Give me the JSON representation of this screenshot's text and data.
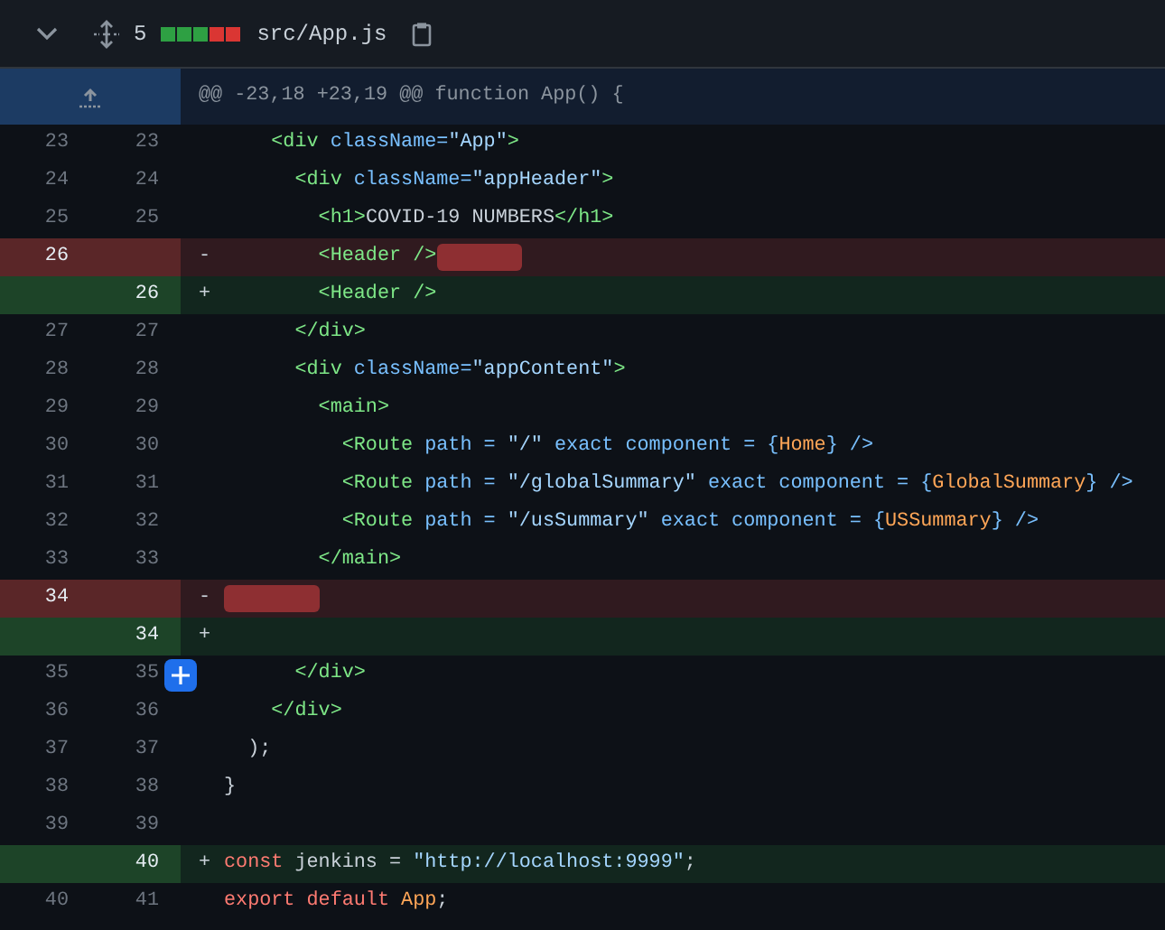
{
  "file_header": {
    "expanded": true,
    "changes": "5",
    "diffstat": [
      {
        "kind": "added"
      },
      {
        "kind": "added"
      },
      {
        "kind": "added"
      },
      {
        "kind": "deleted"
      },
      {
        "kind": "deleted"
      }
    ],
    "path": "src/App.js"
  },
  "hunk": {
    "text": "@@ -23,18 +23,19 @@ function App() {"
  },
  "lines": [
    {
      "kind": "context",
      "old": "23",
      "new": "23",
      "tokens": [
        {
          "kind": "tag",
          "text": "    <div "
        },
        {
          "kind": "attr",
          "text": "className="
        },
        {
          "kind": "str",
          "text": "\"App\""
        },
        {
          "kind": "tag",
          "text": ">"
        }
      ]
    },
    {
      "kind": "context",
      "old": "24",
      "new": "24",
      "tokens": [
        {
          "kind": "tag",
          "text": "      <div "
        },
        {
          "kind": "attr",
          "text": "className="
        },
        {
          "kind": "str",
          "text": "\"appHeader\""
        },
        {
          "kind": "tag",
          "text": ">"
        }
      ]
    },
    {
      "kind": "context",
      "old": "25",
      "new": "25",
      "tokens": [
        {
          "kind": "tag",
          "text": "        <h1>"
        },
        {
          "kind": "plain",
          "text": "COVID-19 NUMBERS"
        },
        {
          "kind": "tag",
          "text": "</h1>"
        }
      ]
    },
    {
      "kind": "del",
      "old": "26",
      "sign": "-",
      "whitespace_removed": true,
      "tokens": [
        {
          "kind": "tag",
          "text": "        <Header />"
        }
      ]
    },
    {
      "kind": "add",
      "new": "26",
      "sign": "+",
      "tokens": [
        {
          "kind": "tag",
          "text": "        <Header />"
        }
      ]
    },
    {
      "kind": "context",
      "old": "27",
      "new": "27",
      "tokens": [
        {
          "kind": "tag",
          "text": "      </div>"
        }
      ]
    },
    {
      "kind": "context",
      "old": "28",
      "new": "28",
      "tokens": [
        {
          "kind": "tag",
          "text": "      <div "
        },
        {
          "kind": "attr",
          "text": "className="
        },
        {
          "kind": "str",
          "text": "\"appContent\""
        },
        {
          "kind": "tag",
          "text": ">"
        }
      ]
    },
    {
      "kind": "context",
      "old": "29",
      "new": "29",
      "tokens": [
        {
          "kind": "tag",
          "text": "        <main>"
        }
      ]
    },
    {
      "kind": "context",
      "old": "30",
      "new": "30",
      "tokens": [
        {
          "kind": "tag",
          "text": "          <Route "
        },
        {
          "kind": "attr",
          "text": "path = "
        },
        {
          "kind": "str",
          "text": "\"/\""
        },
        {
          "kind": "attr",
          "text": " exact component = {"
        },
        {
          "kind": "const",
          "text": "Home"
        },
        {
          "kind": "attr",
          "text": "} />"
        }
      ]
    },
    {
      "kind": "context",
      "old": "31",
      "new": "31",
      "tokens": [
        {
          "kind": "tag",
          "text": "          <Route "
        },
        {
          "kind": "attr",
          "text": "path = "
        },
        {
          "kind": "str",
          "text": "\"/globalSummary\""
        },
        {
          "kind": "attr",
          "text": " exact component = {"
        },
        {
          "kind": "const",
          "text": "GlobalSummary"
        },
        {
          "kind": "attr",
          "text": "} />"
        }
      ]
    },
    {
      "kind": "context",
      "old": "32",
      "new": "32",
      "tokens": [
        {
          "kind": "tag",
          "text": "          <Route "
        },
        {
          "kind": "attr",
          "text": "path = "
        },
        {
          "kind": "str",
          "text": "\"/usSummary\""
        },
        {
          "kind": "attr",
          "text": " exact component = {"
        },
        {
          "kind": "const",
          "text": "USSummary"
        },
        {
          "kind": "attr",
          "text": "} />"
        }
      ]
    },
    {
      "kind": "context",
      "old": "33",
      "new": "33",
      "tokens": [
        {
          "kind": "tag",
          "text": "        </main>"
        }
      ]
    },
    {
      "kind": "del",
      "old": "34",
      "sign": "-",
      "whitespace_removed": true
    },
    {
      "kind": "add",
      "new": "34",
      "sign": "+"
    },
    {
      "kind": "context",
      "old": "35",
      "new": "35",
      "comment_button": true,
      "tokens": [
        {
          "kind": "tag",
          "text": "      </div>"
        }
      ]
    },
    {
      "kind": "context",
      "old": "36",
      "new": "36",
      "tokens": [
        {
          "kind": "tag",
          "text": "    </div>"
        }
      ]
    },
    {
      "kind": "context",
      "old": "37",
      "new": "37",
      "tokens": [
        {
          "kind": "plain",
          "text": "  );"
        }
      ]
    },
    {
      "kind": "context",
      "old": "38",
      "new": "38",
      "tokens": [
        {
          "kind": "plain",
          "text": "}"
        }
      ]
    },
    {
      "kind": "context",
      "old": "39",
      "new": "39"
    },
    {
      "kind": "add",
      "new": "40",
      "sign": "+",
      "tokens": [
        {
          "kind": "kw",
          "text": "const"
        },
        {
          "kind": "plain",
          "text": " jenkins = "
        },
        {
          "kind": "str",
          "text": "\"http://localhost:9999\""
        },
        {
          "kind": "plain",
          "text": ";"
        }
      ]
    },
    {
      "kind": "context",
      "old": "40",
      "new": "41",
      "tokens": [
        {
          "kind": "kw",
          "text": "export default "
        },
        {
          "kind": "const",
          "text": "App"
        },
        {
          "kind": "plain",
          "text": ";"
        }
      ]
    }
  ]
}
